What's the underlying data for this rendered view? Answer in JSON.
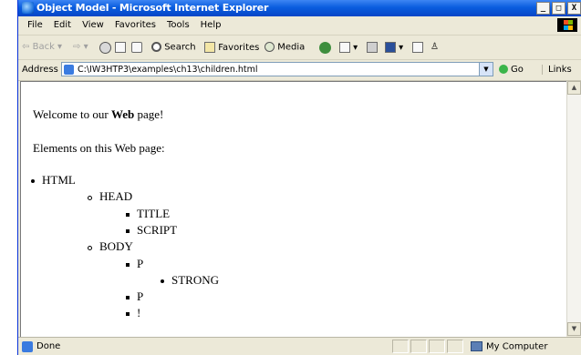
{
  "window": {
    "title": "Object Model - Microsoft Internet Explorer",
    "minimize": "_",
    "maximize": "□",
    "close": "X"
  },
  "menu": [
    "File",
    "Edit",
    "View",
    "Favorites",
    "Tools",
    "Help"
  ],
  "toolbar": {
    "back": "Back",
    "search": "Search",
    "favorites": "Favorites",
    "media": "Media"
  },
  "address": {
    "label": "Address",
    "url": "C:\\IW3HTP3\\examples\\ch13\\children.html",
    "go": "Go",
    "links": "Links"
  },
  "content": {
    "welcome_before": "Welcome to our ",
    "welcome_bold": "Web",
    "welcome_after": " page!",
    "elements_heading": "Elements on this Web page:",
    "tree": [
      {
        "label": "HTML",
        "level": 1,
        "bullet": "disc"
      },
      {
        "label": "HEAD",
        "level": 2,
        "bullet": "circle"
      },
      {
        "label": "TITLE",
        "level": 3,
        "bullet": "square"
      },
      {
        "label": "SCRIPT",
        "level": 3,
        "bullet": "square"
      },
      {
        "label": "BODY",
        "level": 2,
        "bullet": "circle"
      },
      {
        "label": "P",
        "level": 3,
        "bullet": "square"
      },
      {
        "label": "STRONG",
        "level": 4,
        "bullet": "disc"
      },
      {
        "label": "P",
        "level": 3,
        "bullet": "square"
      },
      {
        "label": "!",
        "level": 3,
        "bullet": "square"
      }
    ]
  },
  "status": {
    "text": "Done",
    "zone": "My Computer"
  }
}
